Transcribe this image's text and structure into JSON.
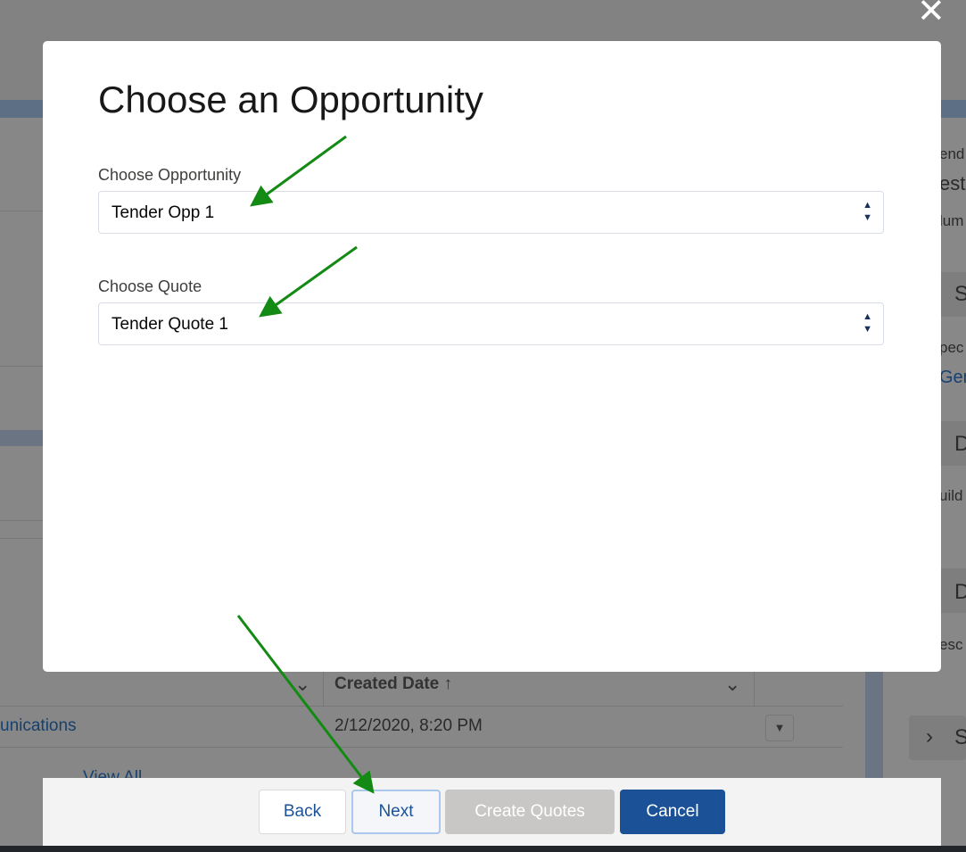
{
  "background": {
    "col_created": "Created Date ↑",
    "row_link": "unications",
    "row_date": "2/12/2020, 8:20 PM",
    "view_all": "View All",
    "right_fragments": [
      "end",
      "est",
      "lum",
      "S",
      "pec",
      "Gen",
      "D",
      "uild",
      "D",
      "esc",
      "S"
    ]
  },
  "modal": {
    "title": "Choose an Opportunity",
    "opportunity": {
      "label": "Choose Opportunity",
      "value": "Tender Opp 1"
    },
    "quote": {
      "label": "Choose Quote",
      "value": "Tender Quote 1"
    }
  },
  "footer": {
    "back": "Back",
    "next": "Next",
    "create_quotes": "Create Quotes",
    "cancel": "Cancel"
  },
  "close_icon": "close-icon",
  "colors": {
    "brand": "#1b5297",
    "arrow": "#138a13",
    "disabled": "#c9c7c5"
  }
}
